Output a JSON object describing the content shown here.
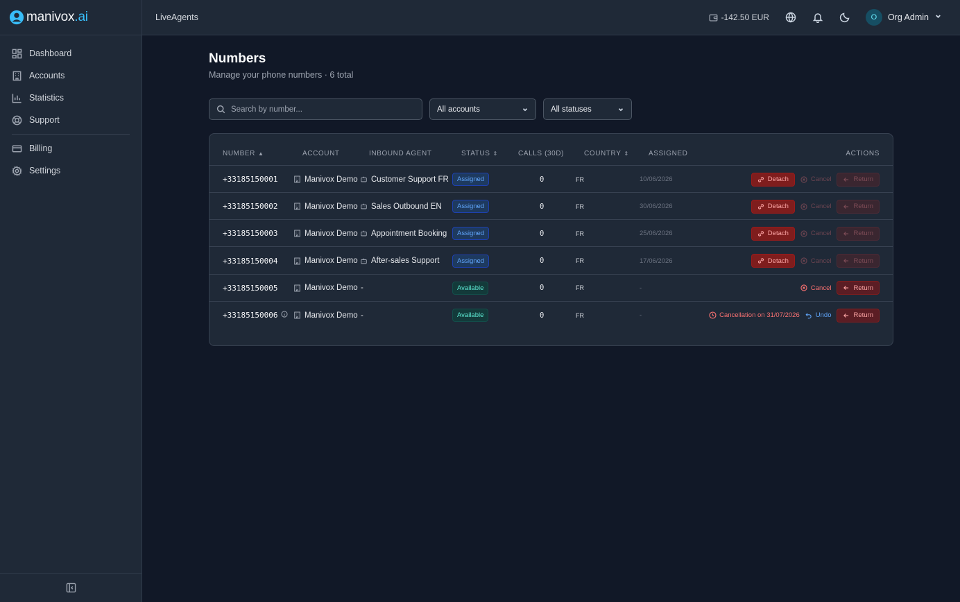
{
  "brand": {
    "name_main": "manivox",
    "name_suffix": ".ai",
    "accent": "#38bdf8"
  },
  "sidebar": {
    "items": [
      {
        "label": "Dashboard",
        "icon": "dashboard-icon"
      },
      {
        "label": "Accounts",
        "icon": "building-icon"
      },
      {
        "label": "Statistics",
        "icon": "bar-chart-icon"
      },
      {
        "label": "Support",
        "icon": "lifebuoy-icon"
      },
      {
        "label": "Billing",
        "icon": "credit-card-icon"
      },
      {
        "label": "Settings",
        "icon": "gear-icon"
      }
    ]
  },
  "topbar": {
    "org": "LiveAgents",
    "balance": "-142.50 EUR",
    "user_initial": "O",
    "user_name": "Org Admin"
  },
  "page": {
    "title": "Numbers",
    "subtitle": "Manage your phone numbers · 6 total"
  },
  "filters": {
    "search_placeholder": "Search by number...",
    "account_filter": "All accounts",
    "status_filter": "All statuses"
  },
  "table": {
    "columns": {
      "number": "Number",
      "account": "Account",
      "inbound_agent": "Inbound Agent",
      "status": "Status",
      "calls": "Calls (30d)",
      "country": "Country",
      "assigned": "Assigned",
      "actions": "Actions"
    },
    "action_labels": {
      "detach": "Detach",
      "cancel": "Cancel",
      "return": "Return",
      "undo": "Undo"
    },
    "rows": [
      {
        "number": "+33185150001",
        "account": "Manivox Demo",
        "agent": "Customer Support FR",
        "status": "Assigned",
        "calls": "0",
        "country": "FR",
        "assigned": "10/06/2026"
      },
      {
        "number": "+33185150002",
        "account": "Manivox Demo",
        "agent": "Sales Outbound EN",
        "status": "Assigned",
        "calls": "0",
        "country": "FR",
        "assigned": "30/06/2026"
      },
      {
        "number": "+33185150003",
        "account": "Manivox Demo",
        "agent": "Appointment Booking",
        "status": "Assigned",
        "calls": "0",
        "country": "FR",
        "assigned": "25/06/2026"
      },
      {
        "number": "+33185150004",
        "account": "Manivox Demo",
        "agent": "After-sales Support",
        "status": "Assigned",
        "calls": "0",
        "country": "FR",
        "assigned": "17/06/2026"
      },
      {
        "number": "+33185150005",
        "account": "Manivox Demo",
        "agent": "-",
        "status": "Available",
        "calls": "0",
        "country": "FR",
        "assigned": "-"
      },
      {
        "number": "+33185150006",
        "account": "Manivox Demo",
        "agent": "-",
        "status": "Available",
        "calls": "0",
        "country": "FR",
        "assigned": "-",
        "cancellation_note": "Cancellation on 31/07/2026"
      }
    ]
  }
}
